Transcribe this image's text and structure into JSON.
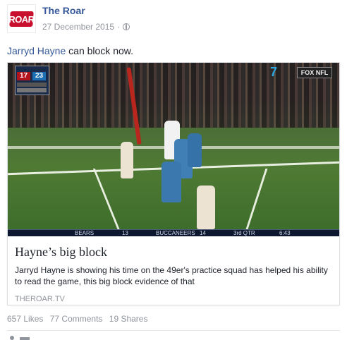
{
  "post": {
    "page_name": "The Roar",
    "page_logo_text": "ROAR",
    "date": "27 December 2015",
    "date_separator": "·",
    "privacy_icon": "globe-icon",
    "text_mention": "Jarryd Hayne",
    "text_rest": " can block now."
  },
  "link_preview": {
    "image_icon": "football-video-thumbnail",
    "title": "Hayne’s big block",
    "description": "Jarryd Hayne is showing his time on the 49er's practice squad has helped his ability to read the game, this big block evidence of that",
    "domain": "THEROAR.TV"
  },
  "scoreboard": {
    "home_score": "17",
    "away_score": "23",
    "ticker": {
      "team1": "BEARS",
      "score1": "13",
      "team2": "BUCCANEERS",
      "score2": "14",
      "quarter": "3rd QTR",
      "clock": "6:43"
    },
    "network": "FOX NFL",
    "channel": "7"
  },
  "engagement": {
    "likes": "657 Likes",
    "comments": "77 Comments",
    "shares": "19 Shares"
  },
  "colors": {
    "link_blue": "#365899",
    "muted_gray": "#90949c",
    "brand_red": "#c8102e"
  }
}
